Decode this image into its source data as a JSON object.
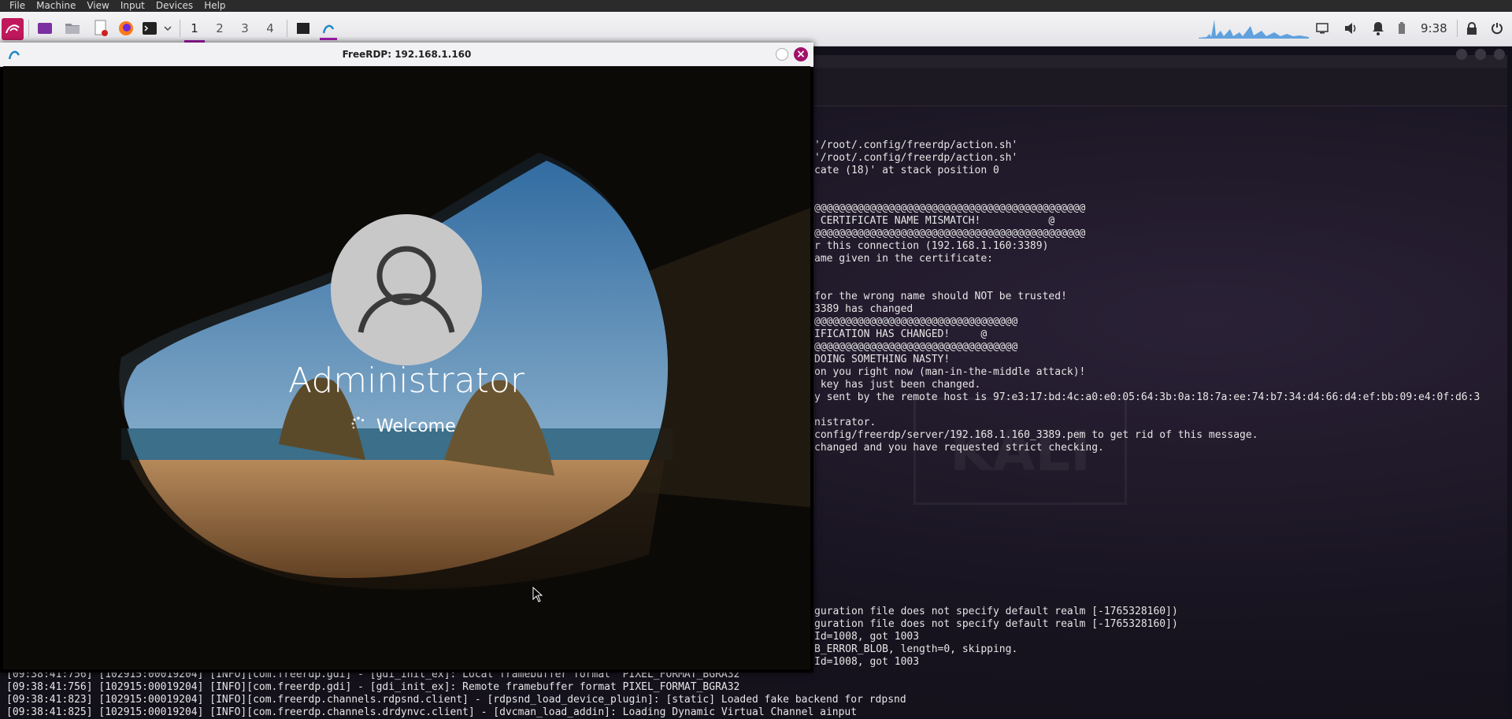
{
  "vm_menu": [
    "File",
    "Machine",
    "View",
    "Input",
    "Devices",
    "Help"
  ],
  "panel": {
    "workspaces": [
      "1",
      "2",
      "3",
      "4"
    ],
    "active_workspace": "1",
    "clock": "9:38",
    "icons": [
      "kali-menu-icon",
      "desktop-icon",
      "file-manager-icon",
      "text-editor-icon",
      "firefox-icon",
      "terminal-icon",
      "terminal-dropdown-icon",
      "terminal-window-icon",
      "freerdp-window-icon",
      "cpu-graph-icon",
      "display-icon",
      "volume-icon",
      "notification-icon",
      "battery-icon",
      "lock-icon",
      "power-icon"
    ]
  },
  "rdp_window": {
    "title": "FreeRDP: 192.168.1.160",
    "login": {
      "username": "Administrator",
      "status": "Welcome"
    }
  },
  "terminal": {
    "lines": [
      "'/root/.config/freerdp/action.sh'",
      "'/root/.config/freerdp/action.sh'",
      "cate (18)' at stack position 0",
      "",
      "",
      "@@@@@@@@@@@@@@@@@@@@@@@@@@@@@@@@@@@@@@@@@@@@",
      " CERTIFICATE NAME MISMATCH!           @",
      "@@@@@@@@@@@@@@@@@@@@@@@@@@@@@@@@@@@@@@@@@@@@",
      "r this connection (192.168.1.160:3389)",
      "ame given in the certificate:",
      "",
      "",
      "for the wrong name should NOT be trusted!",
      "3389 has changed",
      "@@@@@@@@@@@@@@@@@@@@@@@@@@@@@@@@@",
      "IFICATION HAS CHANGED!     @",
      "@@@@@@@@@@@@@@@@@@@@@@@@@@@@@@@@@",
      "DOING SOMETHING NASTY!",
      "on you right now (man-in-the-middle attack)!",
      " key has just been changed.",
      "y sent by the remote host is 97:e3:17:bd:4c:a0:e0:05:64:3b:0a:18:7a:ee:74:b7:34:d4:66:d4:ef:bb:09:e4:0f:d6:3",
      "",
      "nistrator.",
      "config/freerdp/server/192.168.1.160_3389.pem to get rid of this message.",
      "changed and you have requested strict checking."
    ],
    "lower_lines": [
      "guration file does not specify default realm [-1765328160])",
      "guration file does not specify default realm [-1765328160])",
      "Id=1008, got 1003",
      "B_ERROR_BLOB, length=0, skipping.",
      "Id=1008, got 1003"
    ],
    "bottom_lines": [
      "[09:38:41:756] [102915:00019204] [INFO][com.freerdp.gdi] - [gdi_init_ex]: Local framebuffer format  PIXEL_FORMAT_BGRA32",
      "[09:38:41:756] [102915:00019204] [INFO][com.freerdp.gdi] - [gdi_init_ex]: Remote framebuffer format PIXEL_FORMAT_BGRA32",
      "[09:38:41:823] [102915:00019204] [INFO][com.freerdp.channels.rdpsnd.client] - [rdpsnd_load_device_plugin]: [static] Loaded fake backend for rdpsnd",
      "[09:38:41:825] [102915:00019204] [INFO][com.freerdp.channels.drdynvc.client] - [dvcman_load_addin]: Loading Dynamic Virtual Channel ainput"
    ]
  }
}
